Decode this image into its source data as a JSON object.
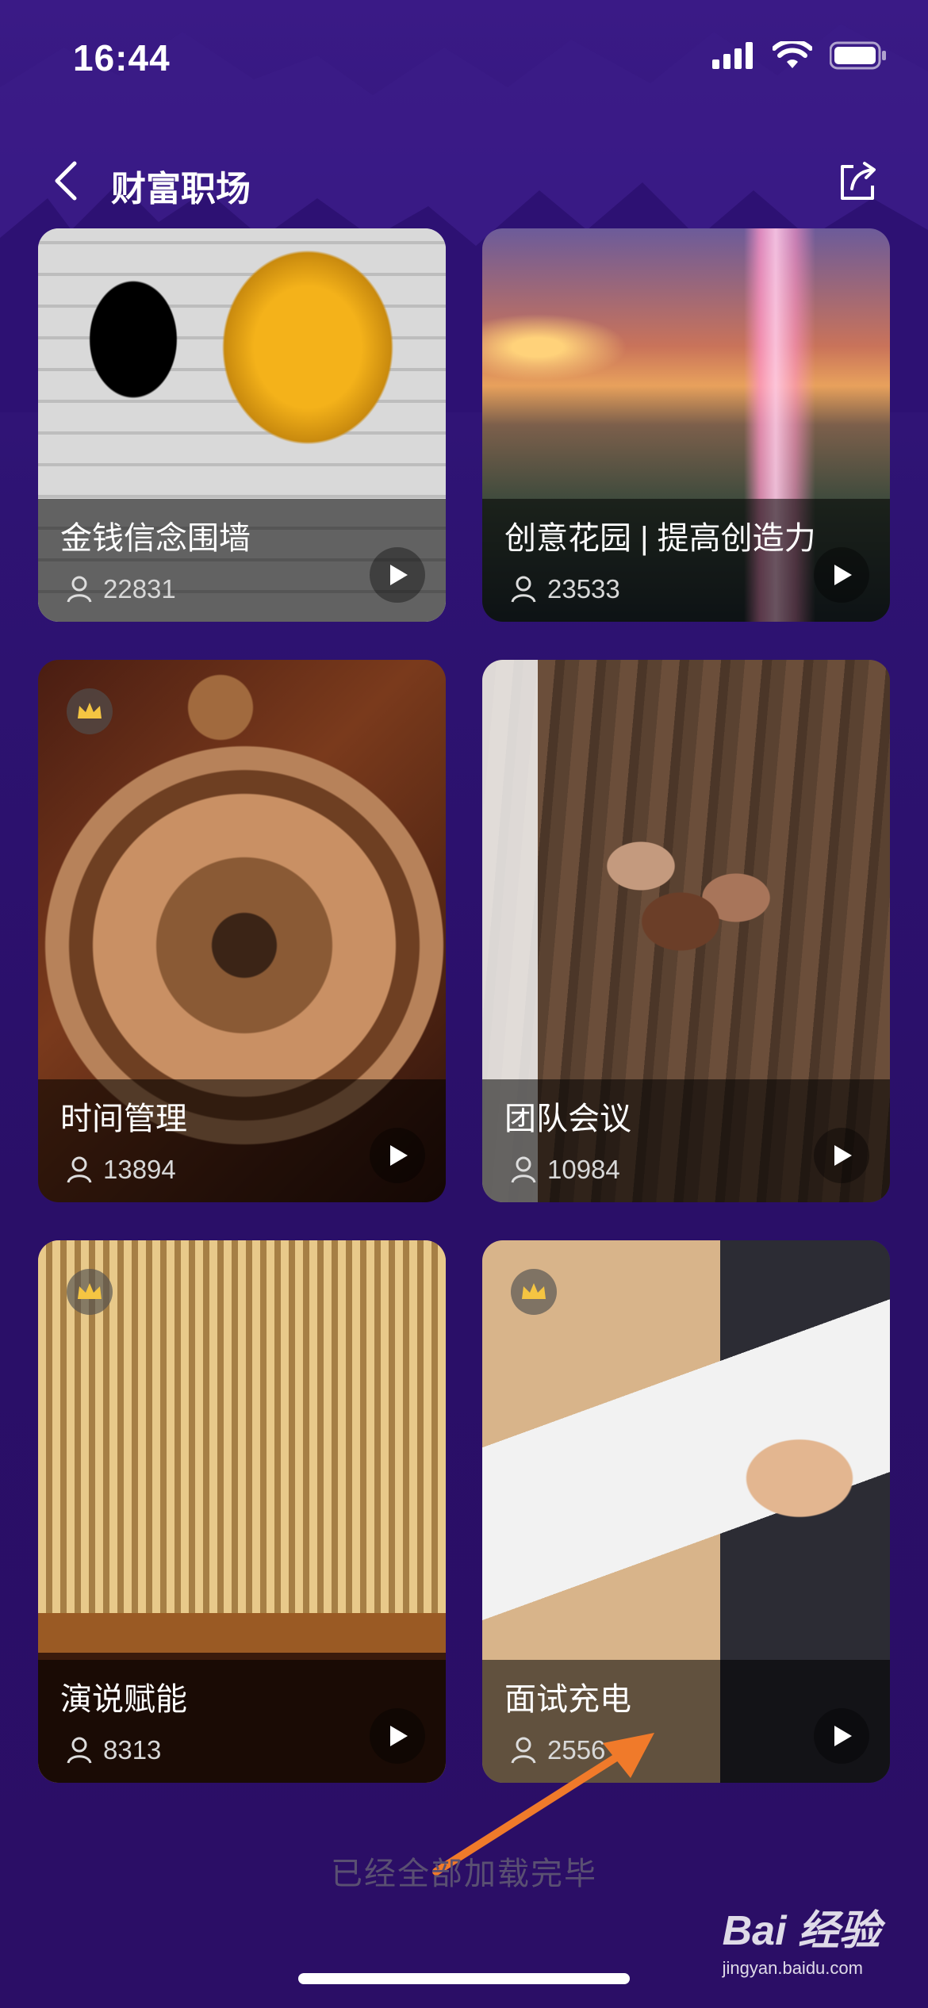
{
  "status": {
    "time": "16:44"
  },
  "nav": {
    "title": "财富职场"
  },
  "cards": [
    {
      "title": "金钱信念围墙",
      "count": "22831",
      "crown": false
    },
    {
      "title": "创意花园 | 提高创造力",
      "count": "23533",
      "crown": false
    },
    {
      "title": "时间管理",
      "count": "13894",
      "crown": true
    },
    {
      "title": "团队会议",
      "count": "10984",
      "crown": false
    },
    {
      "title": "演说赋能",
      "count": "8313",
      "crown": true
    },
    {
      "title": "面试充电",
      "count": "2556",
      "crown": true
    }
  ],
  "footer": {
    "text": "已经全部加载完毕"
  },
  "watermark": {
    "logo": "Bai 经验",
    "url": "jingyan.baidu.com"
  },
  "colors": {
    "background": "#2a1064",
    "arrow": "#f07a2a"
  }
}
